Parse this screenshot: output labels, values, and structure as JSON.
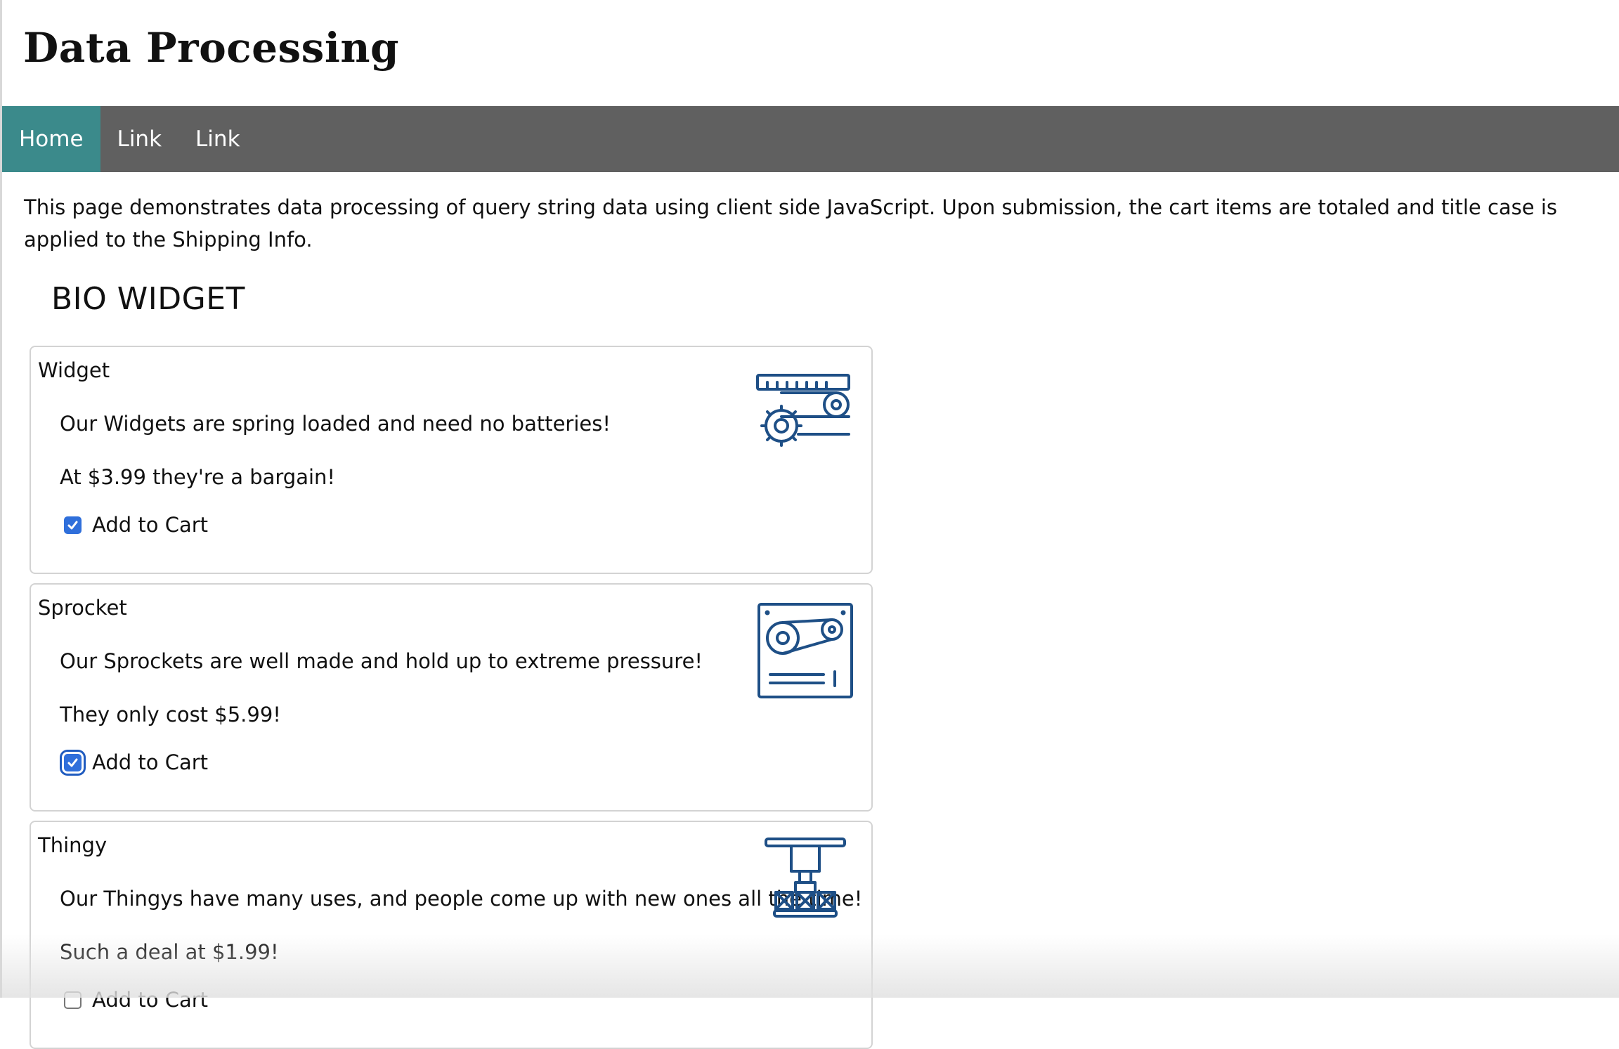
{
  "site": {
    "title": "Data Processing"
  },
  "nav": {
    "items": [
      "Home",
      "Link",
      "Link"
    ],
    "active_index": 0
  },
  "intro": "This page demonstrates data processing of query string data using client side JavaScript. Upon submission, the cart items are totaled and title case is applied to the Shipping Info.",
  "section": {
    "title": "BIO WIDGET"
  },
  "products": [
    {
      "name": "Widget",
      "description": "Our Widgets are spring loaded and need no batteries!",
      "price_text": "At $3.99 they're a bargain!",
      "cart_label": "Add to Cart",
      "checked": true,
      "icon": "conveyor-gear-icon"
    },
    {
      "name": "Sprocket",
      "description": "Our Sprockets are well made and hold up to extreme pressure!",
      "price_text": "They only cost $5.99!",
      "cart_label": "Add to Cart",
      "checked": true,
      "icon": "machine-panel-icon"
    },
    {
      "name": "Thingy",
      "description": "Our Thingys have many uses, and people come up with new ones all the time!",
      "price_text": "Such a deal at $1.99!",
      "cart_label": "Add to Cart",
      "checked": false,
      "icon": "press-boxes-icon"
    }
  ],
  "colors": {
    "nav_bg": "#606060",
    "nav_active": "#3b8a8b",
    "icon_blue": "#1e4f86",
    "checkbox_blue": "#2f6fdb"
  }
}
